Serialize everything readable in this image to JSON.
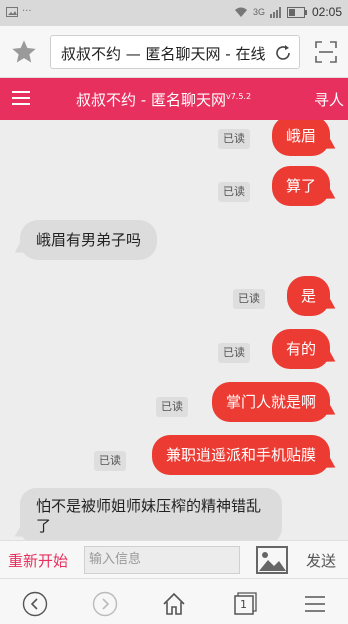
{
  "status": {
    "time": "02:05",
    "signal": "3G"
  },
  "browser": {
    "url_text": "叔叔不约 — 匿名聊天网 - 在线"
  },
  "app": {
    "title": "叔叔不约 - 匿名聊天网",
    "version": "v7.5.2",
    "right_text": "寻人"
  },
  "chat": {
    "read_label": "已读",
    "messages": [
      {
        "side": "out",
        "text": "峨眉",
        "read": true
      },
      {
        "side": "out",
        "text": "算了",
        "read": true
      },
      {
        "side": "in",
        "text": "峨眉有男弟子吗"
      },
      {
        "side": "out",
        "text": "是",
        "read": true
      },
      {
        "side": "out",
        "text": "有的",
        "read": true
      },
      {
        "side": "out",
        "text": "掌门人就是啊",
        "read": true
      },
      {
        "side": "out",
        "text": "兼职逍遥派和手机贴膜",
        "read": true
      },
      {
        "side": "in",
        "text": "怕不是被师姐师妹压榨的精神错乱了"
      }
    ]
  },
  "input": {
    "restart_label": "重新开始",
    "placeholder": "输入信息",
    "send_label": "发送"
  },
  "nav": {
    "tabs_count": "1"
  },
  "colors": {
    "accent": "#e8305f",
    "bubble_out": "#ec3b33",
    "bubble_in": "#dcdcdc"
  }
}
